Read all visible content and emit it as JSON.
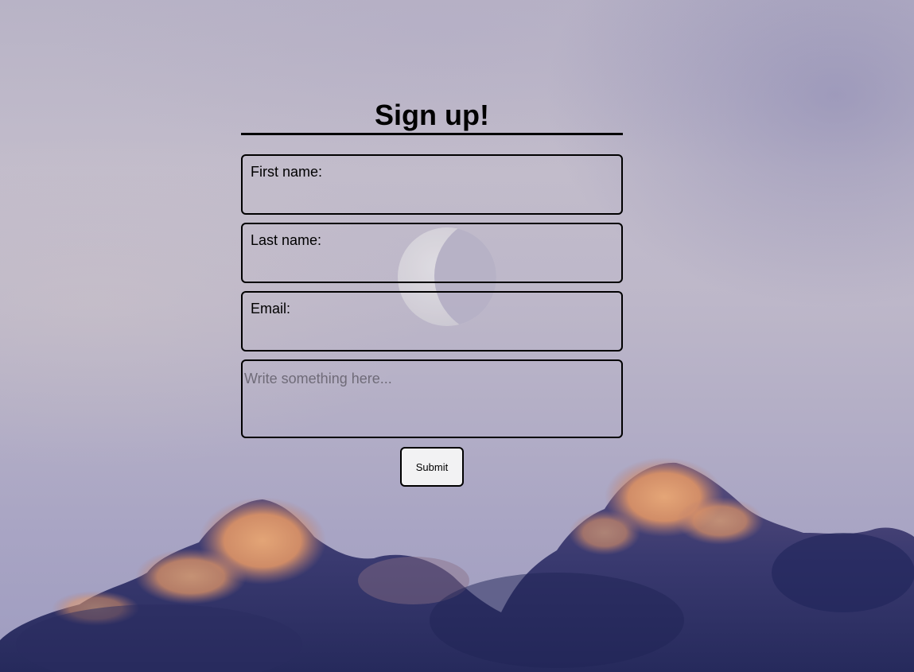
{
  "form": {
    "title": "Sign up!",
    "fields": [
      {
        "label": "First name:",
        "value": ""
      },
      {
        "label": "Last name:",
        "value": ""
      },
      {
        "label": "Email:",
        "value": ""
      }
    ],
    "message_placeholder": "Write something here...",
    "submit_label": "Submit"
  },
  "colors": {
    "text": "#000000",
    "sky": "#b9b4c8",
    "cloud_highlight": "#f0a26a",
    "cloud_shadow": "#2e2f63",
    "button_bg": "#f2f2f3"
  }
}
